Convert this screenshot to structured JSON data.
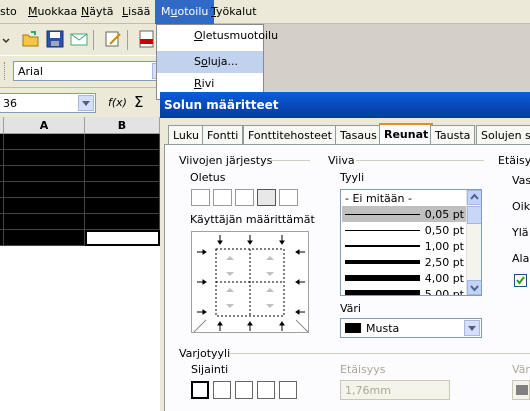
{
  "menubar": {
    "items": [
      {
        "label": "sto"
      },
      {
        "label": "Muokkaa"
      },
      {
        "label": "Näytä"
      },
      {
        "label": "Lisää"
      },
      {
        "label": "Muotoilu"
      },
      {
        "label": "Työkalut"
      }
    ]
  },
  "dropdown": {
    "items": [
      {
        "label": "Oletusmuotoilu"
      },
      {
        "label": "Soluja..."
      },
      {
        "label": "Rivi"
      }
    ]
  },
  "toolbar": {
    "font_name": "Arial",
    "cell_ref": "36",
    "function_wizard": "f(x)",
    "sum_symbol": "Σ"
  },
  "sheet": {
    "columns": [
      "A",
      "B"
    ]
  },
  "dialog": {
    "title": "Solun määritteet",
    "tabs": [
      "Luku",
      "Fontti",
      "Fonttitehosteet",
      "Tasaus",
      "Reunat",
      "Tausta",
      "Solujen su"
    ],
    "selected_tab": "Reunat",
    "line_arrangement": {
      "heading": "Viivojen järjestys",
      "default_label": "Oletus",
      "user_defined_label": "Käyttäjän määrittämät"
    },
    "line": {
      "heading": "Viiva",
      "style_label": "Tyyli",
      "styles": [
        "- Ei mitään -",
        "0,05 pt",
        "0,50 pt",
        "1,00 pt",
        "2,50 pt",
        "4,00 pt",
        "5,00 pt"
      ],
      "selected_style": "0,05 pt",
      "color_label": "Väri",
      "color_value": "Musta"
    },
    "spacing": {
      "heading": "Etäisyy",
      "items": [
        "Vas",
        "Oik",
        "Ylä",
        "Ala"
      ]
    },
    "shadow": {
      "heading": "Varjotyyli",
      "position_label": "Sijainti",
      "distance_label": "Etäisyys",
      "distance_value": "1,76mm",
      "color_label": "Vär"
    }
  },
  "colors": {
    "title_bar": "#0a5fd8",
    "menu_highlight": "#316ac5",
    "tab_accent": "#e68b2c",
    "line_color": "#000000"
  }
}
